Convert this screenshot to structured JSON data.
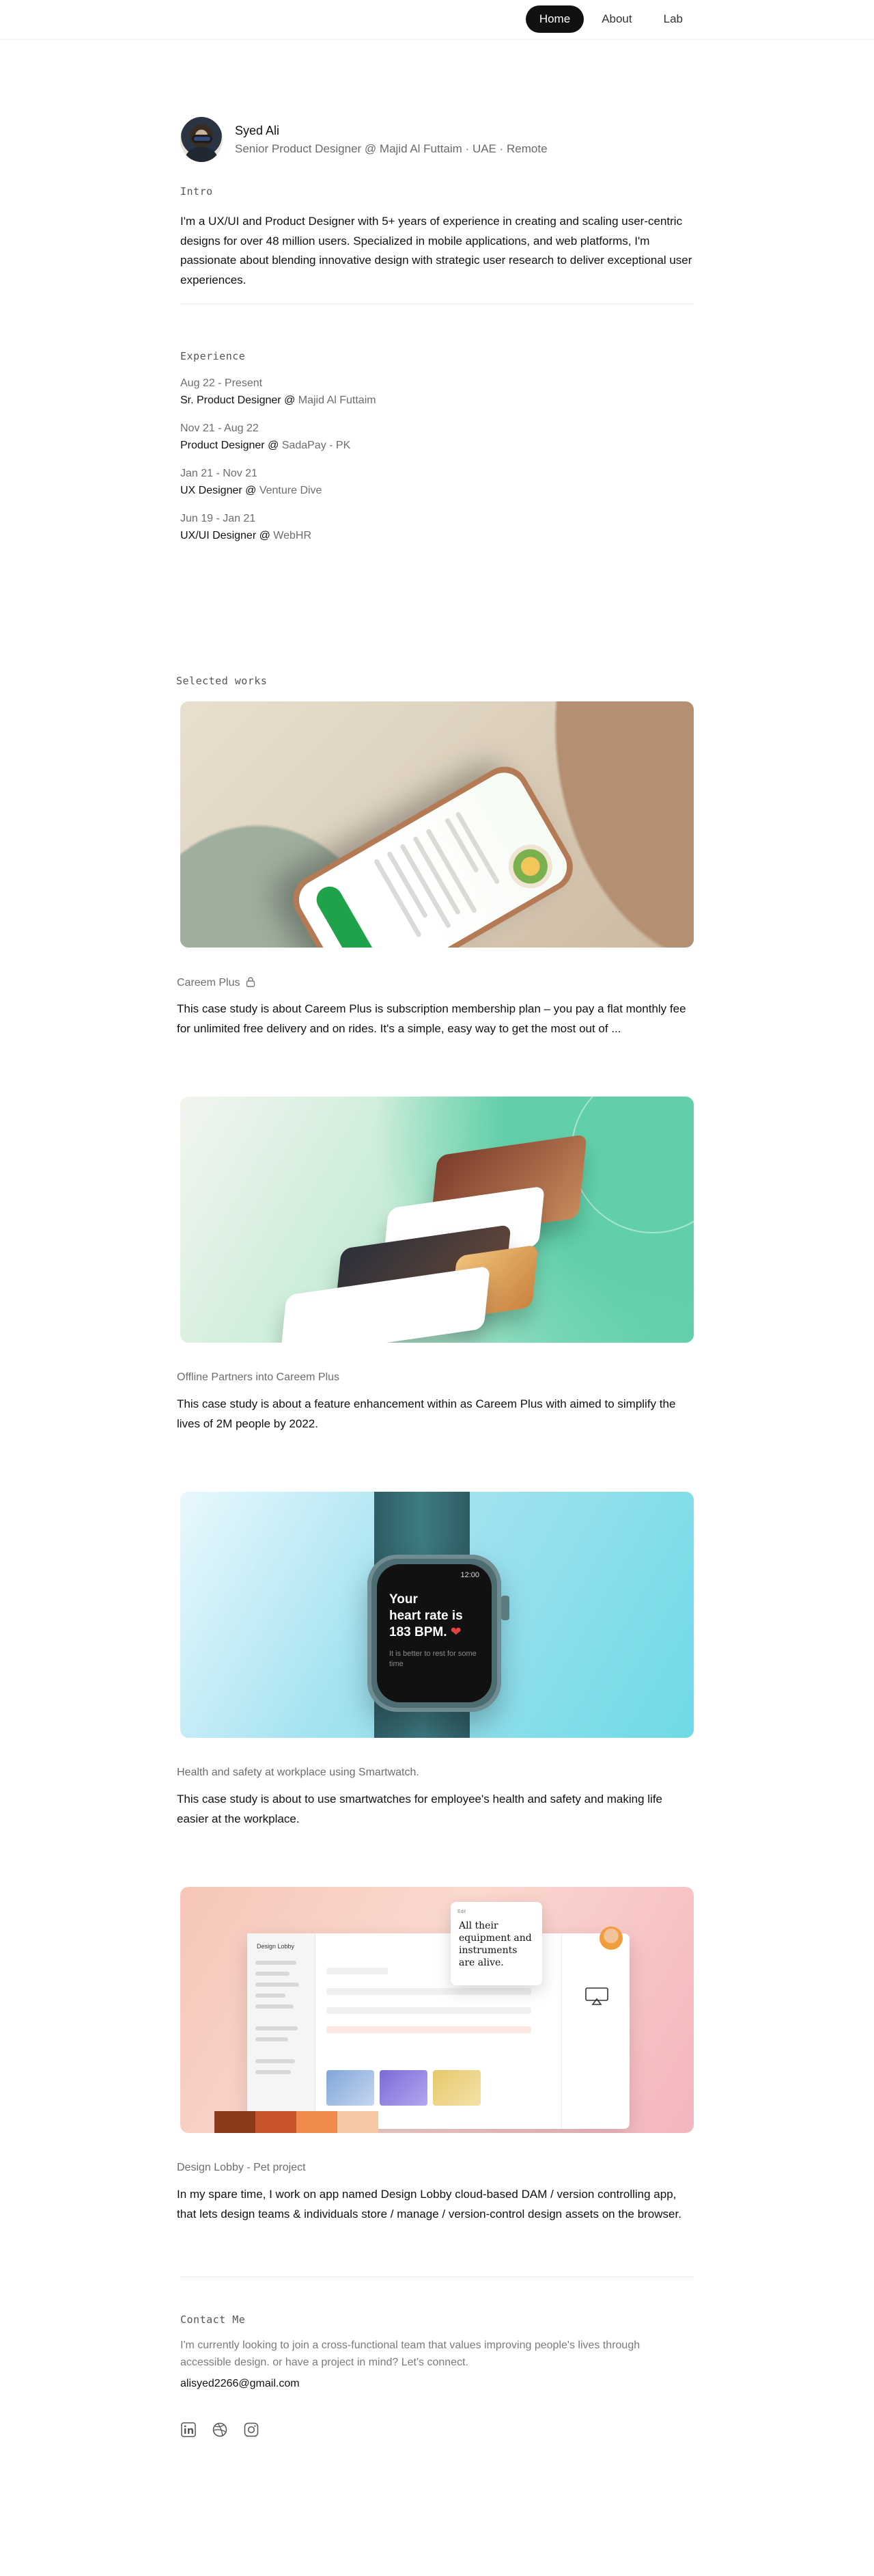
{
  "nav": {
    "items": [
      {
        "label": "Home",
        "active": true
      },
      {
        "label": "About",
        "active": false
      },
      {
        "label": "Lab",
        "active": false
      }
    ]
  },
  "profile": {
    "name": "Syed Ali",
    "role": "Senior Product Designer @ Majid Al Futtaim · UAE · Remote"
  },
  "intro": {
    "label": "Intro",
    "text": "I'm a UX/UI and Product Designer with 5+ years of experience in creating and scaling user-centric designs for over 48 million users. Specialized in mobile applications, and web platforms, I'm passionate about blending innovative design with strategic user research to deliver exceptional user experiences."
  },
  "experience": {
    "label": "Experience",
    "items": [
      {
        "date": "Aug 22 - Present",
        "title": "Sr. Product Designer @ ",
        "company": "Majid Al Futtaim"
      },
      {
        "date": "Nov 21 - Aug 22",
        "title": "Product Designer @ ",
        "company": "SadaPay - PK"
      },
      {
        "date": "Jan 21 - Nov 21",
        "title": "UX Designer @ ",
        "company": "Venture Dive"
      },
      {
        "date": "Jun 19 - Jan 21",
        "title": "UX/UI Designer @ ",
        "company": "WebHR"
      }
    ]
  },
  "works": {
    "label": "Selected works",
    "items": [
      {
        "title": "Careem Plus",
        "locked": true,
        "desc": "This case study is about Careem Plus is subscription membership plan – you pay a flat monthly fee for unlimited free delivery and on rides. It's a simple, easy way to get the most out of ..."
      },
      {
        "title": "Offline Partners into Careem Plus",
        "locked": false,
        "desc": "This case study is about a feature enhancement within as Careem Plus with aimed to simplify the lives of 2M people by 2022."
      },
      {
        "title": "Health and safety at workplace using Smartwatch.",
        "locked": false,
        "desc": "This case study is about to use smartwatches for employee's health and safety and making life easier at the workplace.",
        "watch": {
          "time": "12:00",
          "line1": "Your",
          "line2": "heart rate is",
          "line3": "183 BPM.",
          "hint": "It is better to rest for some time"
        }
      },
      {
        "title": "Design Lobby - Pet project",
        "locked": false,
        "desc": "In my spare time, I work on app named Design Lobby cloud-based DAM / version controlling app, that lets design teams & individuals store / manage / version-control design assets on the browser.",
        "app": {
          "name": "Design Lobby",
          "quote": "All their equipment and instruments are alive.",
          "quote_head": "Edit"
        }
      }
    ]
  },
  "contact": {
    "label": "Contact Me",
    "text": "I'm currently looking to join a cross-functional team that values improving people's lives through accessible design. or have a project in mind? Let's connect.",
    "email": "alisyed2266@gmail.com",
    "socials": [
      "linkedin-icon",
      "dribbble-icon",
      "instagram-icon"
    ]
  },
  "colors": {
    "nav_active_bg": "#111111",
    "muted_text": "#6d6d6d",
    "careem_green": "#1ea34a"
  }
}
